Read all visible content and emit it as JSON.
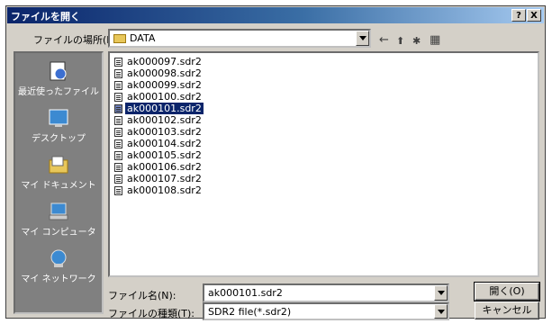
{
  "window": {
    "title": "ファイルを開く",
    "help_btn": "?",
    "close_btn": "X"
  },
  "lookin": {
    "label": "ファイルの場所(I):",
    "value": "DATA"
  },
  "toolbar": {
    "back": "←",
    "up": "⬆",
    "newfolder": "✱",
    "views": "▦"
  },
  "places": [
    {
      "label": "最近使ったファイル",
      "icon": "recent-icon"
    },
    {
      "label": "デスクトップ",
      "icon": "desktop-icon"
    },
    {
      "label": "マイ ドキュメント",
      "icon": "mydocuments-icon"
    },
    {
      "label": "マイ コンピュータ",
      "icon": "mycomputer-icon"
    },
    {
      "label": "マイ ネットワーク",
      "icon": "network-icon"
    }
  ],
  "files": [
    {
      "name": "ak000097.sdr2",
      "selected": false
    },
    {
      "name": "ak000098.sdr2",
      "selected": false
    },
    {
      "name": "ak000099.sdr2",
      "selected": false
    },
    {
      "name": "ak000100.sdr2",
      "selected": false
    },
    {
      "name": "ak000101.sdr2",
      "selected": true
    },
    {
      "name": "ak000102.sdr2",
      "selected": false
    },
    {
      "name": "ak000103.sdr2",
      "selected": false
    },
    {
      "name": "ak000104.sdr2",
      "selected": false
    },
    {
      "name": "ak000105.sdr2",
      "selected": false
    },
    {
      "name": "ak000106.sdr2",
      "selected": false
    },
    {
      "name": "ak000107.sdr2",
      "selected": false
    },
    {
      "name": "ak000108.sdr2",
      "selected": false
    }
  ],
  "filename": {
    "label": "ファイル名(N):",
    "value": "ak000101.sdr2"
  },
  "filetype": {
    "label": "ファイルの種類(T):",
    "value": "SDR2 file(*.sdr2)"
  },
  "buttons": {
    "open": "開く(O)",
    "cancel": "キャンセル"
  },
  "colors": {
    "titlebar": "#0a246a",
    "selection": "#0a246a",
    "face": "#d4d0c8",
    "places_bg": "#808080"
  }
}
